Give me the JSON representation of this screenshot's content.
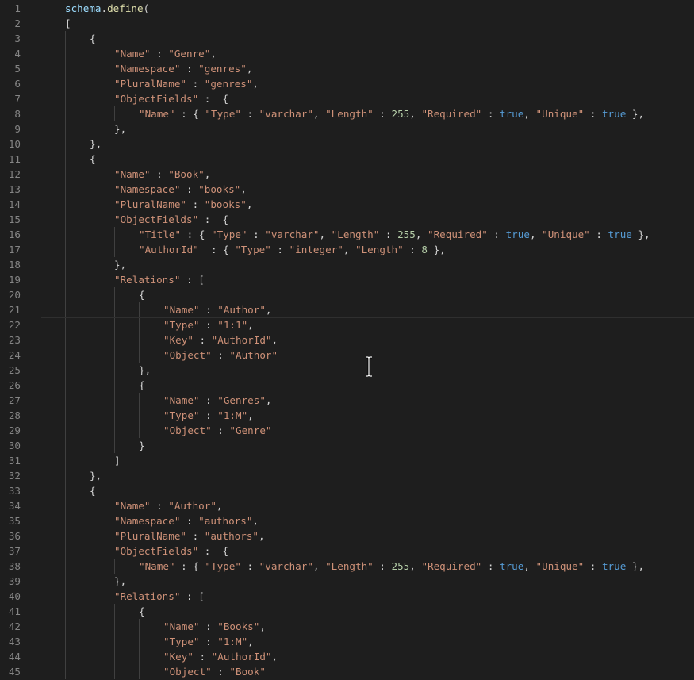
{
  "editor": {
    "lines": [
      {
        "n": "1",
        "indent": 0,
        "tokens": [
          {
            "t": "ident",
            "v": "schema"
          },
          {
            "t": "plain",
            "v": "."
          },
          {
            "t": "func",
            "v": "define"
          },
          {
            "t": "plain",
            "v": "("
          }
        ]
      },
      {
        "n": "2",
        "indent": 0,
        "tokens": [
          {
            "t": "plain",
            "v": "["
          }
        ]
      },
      {
        "n": "3",
        "indent": 1,
        "tokens": [
          {
            "t": "plain",
            "v": "{"
          }
        ]
      },
      {
        "n": "4",
        "indent": 2,
        "tokens": [
          {
            "t": "str",
            "v": "\"Name\""
          },
          {
            "t": "plain",
            "v": " : "
          },
          {
            "t": "str",
            "v": "\"Genre\""
          },
          {
            "t": "plain",
            "v": ","
          }
        ]
      },
      {
        "n": "5",
        "indent": 2,
        "tokens": [
          {
            "t": "str",
            "v": "\"Namespace\""
          },
          {
            "t": "plain",
            "v": " : "
          },
          {
            "t": "str",
            "v": "\"genres\""
          },
          {
            "t": "plain",
            "v": ","
          }
        ]
      },
      {
        "n": "6",
        "indent": 2,
        "tokens": [
          {
            "t": "str",
            "v": "\"PluralName\""
          },
          {
            "t": "plain",
            "v": " : "
          },
          {
            "t": "str",
            "v": "\"genres\""
          },
          {
            "t": "plain",
            "v": ","
          }
        ]
      },
      {
        "n": "7",
        "indent": 2,
        "tokens": [
          {
            "t": "str",
            "v": "\"ObjectFields\""
          },
          {
            "t": "plain",
            "v": " :  {"
          }
        ]
      },
      {
        "n": "8",
        "indent": 3,
        "tokens": [
          {
            "t": "str",
            "v": "\"Name\""
          },
          {
            "t": "plain",
            "v": " : { "
          },
          {
            "t": "str",
            "v": "\"Type\""
          },
          {
            "t": "plain",
            "v": " : "
          },
          {
            "t": "str",
            "v": "\"varchar\""
          },
          {
            "t": "plain",
            "v": ", "
          },
          {
            "t": "str",
            "v": "\"Length\""
          },
          {
            "t": "plain",
            "v": " : "
          },
          {
            "t": "num",
            "v": "255"
          },
          {
            "t": "plain",
            "v": ", "
          },
          {
            "t": "str",
            "v": "\"Required\""
          },
          {
            "t": "plain",
            "v": " : "
          },
          {
            "t": "kw",
            "v": "true"
          },
          {
            "t": "plain",
            "v": ", "
          },
          {
            "t": "str",
            "v": "\"Unique\""
          },
          {
            "t": "plain",
            "v": " : "
          },
          {
            "t": "kw",
            "v": "true"
          },
          {
            "t": "plain",
            "v": " },"
          }
        ]
      },
      {
        "n": "9",
        "indent": 2,
        "tokens": [
          {
            "t": "plain",
            "v": "},"
          }
        ]
      },
      {
        "n": "10",
        "indent": 1,
        "tokens": [
          {
            "t": "plain",
            "v": "},"
          }
        ]
      },
      {
        "n": "11",
        "indent": 1,
        "tokens": [
          {
            "t": "plain",
            "v": "{"
          }
        ]
      },
      {
        "n": "12",
        "indent": 2,
        "tokens": [
          {
            "t": "str",
            "v": "\"Name\""
          },
          {
            "t": "plain",
            "v": " : "
          },
          {
            "t": "str",
            "v": "\"Book\""
          },
          {
            "t": "plain",
            "v": ","
          }
        ]
      },
      {
        "n": "13",
        "indent": 2,
        "tokens": [
          {
            "t": "str",
            "v": "\"Namespace\""
          },
          {
            "t": "plain",
            "v": " : "
          },
          {
            "t": "str",
            "v": "\"books\""
          },
          {
            "t": "plain",
            "v": ","
          }
        ]
      },
      {
        "n": "14",
        "indent": 2,
        "tokens": [
          {
            "t": "str",
            "v": "\"PluralName\""
          },
          {
            "t": "plain",
            "v": " : "
          },
          {
            "t": "str",
            "v": "\"books\""
          },
          {
            "t": "plain",
            "v": ","
          }
        ]
      },
      {
        "n": "15",
        "indent": 2,
        "tokens": [
          {
            "t": "str",
            "v": "\"ObjectFields\""
          },
          {
            "t": "plain",
            "v": " :  {"
          }
        ]
      },
      {
        "n": "16",
        "indent": 3,
        "tokens": [
          {
            "t": "str",
            "v": "\"Title\""
          },
          {
            "t": "plain",
            "v": " : { "
          },
          {
            "t": "str",
            "v": "\"Type\""
          },
          {
            "t": "plain",
            "v": " : "
          },
          {
            "t": "str",
            "v": "\"varchar\""
          },
          {
            "t": "plain",
            "v": ", "
          },
          {
            "t": "str",
            "v": "\"Length\""
          },
          {
            "t": "plain",
            "v": " : "
          },
          {
            "t": "num",
            "v": "255"
          },
          {
            "t": "plain",
            "v": ", "
          },
          {
            "t": "str",
            "v": "\"Required\""
          },
          {
            "t": "plain",
            "v": " : "
          },
          {
            "t": "kw",
            "v": "true"
          },
          {
            "t": "plain",
            "v": ", "
          },
          {
            "t": "str",
            "v": "\"Unique\""
          },
          {
            "t": "plain",
            "v": " : "
          },
          {
            "t": "kw",
            "v": "true"
          },
          {
            "t": "plain",
            "v": " },"
          }
        ]
      },
      {
        "n": "17",
        "indent": 3,
        "tokens": [
          {
            "t": "str",
            "v": "\"AuthorId\""
          },
          {
            "t": "plain",
            "v": "  : { "
          },
          {
            "t": "str",
            "v": "\"Type\""
          },
          {
            "t": "plain",
            "v": " : "
          },
          {
            "t": "str",
            "v": "\"integer\""
          },
          {
            "t": "plain",
            "v": ", "
          },
          {
            "t": "str",
            "v": "\"Length\""
          },
          {
            "t": "plain",
            "v": " : "
          },
          {
            "t": "num",
            "v": "8"
          },
          {
            "t": "plain",
            "v": " },"
          }
        ]
      },
      {
        "n": "18",
        "indent": 2,
        "tokens": [
          {
            "t": "plain",
            "v": "},"
          }
        ]
      },
      {
        "n": "19",
        "indent": 2,
        "tokens": [
          {
            "t": "str",
            "v": "\"Relations\""
          },
          {
            "t": "plain",
            "v": " : ["
          }
        ]
      },
      {
        "n": "20",
        "indent": 3,
        "tokens": [
          {
            "t": "plain",
            "v": "{"
          }
        ]
      },
      {
        "n": "21",
        "indent": 4,
        "tokens": [
          {
            "t": "str",
            "v": "\"Name\""
          },
          {
            "t": "plain",
            "v": " : "
          },
          {
            "t": "str",
            "v": "\"Author\""
          },
          {
            "t": "plain",
            "v": ","
          }
        ]
      },
      {
        "n": "22",
        "indent": 4,
        "current": true,
        "tokens": [
          {
            "t": "str",
            "v": "\"Type\""
          },
          {
            "t": "plain",
            "v": " : "
          },
          {
            "t": "str",
            "v": "\"1:1\""
          },
          {
            "t": "plain",
            "v": ","
          }
        ]
      },
      {
        "n": "23",
        "indent": 4,
        "tokens": [
          {
            "t": "str",
            "v": "\"Key\""
          },
          {
            "t": "plain",
            "v": " : "
          },
          {
            "t": "str",
            "v": "\"AuthorId\""
          },
          {
            "t": "plain",
            "v": ","
          }
        ]
      },
      {
        "n": "24",
        "indent": 4,
        "tokens": [
          {
            "t": "str",
            "v": "\"Object\""
          },
          {
            "t": "plain",
            "v": " : "
          },
          {
            "t": "str",
            "v": "\"Author\""
          }
        ]
      },
      {
        "n": "25",
        "indent": 3,
        "tokens": [
          {
            "t": "plain",
            "v": "},"
          }
        ]
      },
      {
        "n": "26",
        "indent": 3,
        "tokens": [
          {
            "t": "plain",
            "v": "{"
          }
        ]
      },
      {
        "n": "27",
        "indent": 4,
        "tokens": [
          {
            "t": "str",
            "v": "\"Name\""
          },
          {
            "t": "plain",
            "v": " : "
          },
          {
            "t": "str",
            "v": "\"Genres\""
          },
          {
            "t": "plain",
            "v": ","
          }
        ]
      },
      {
        "n": "28",
        "indent": 4,
        "tokens": [
          {
            "t": "str",
            "v": "\"Type\""
          },
          {
            "t": "plain",
            "v": " : "
          },
          {
            "t": "str",
            "v": "\"1:M\""
          },
          {
            "t": "plain",
            "v": ","
          }
        ]
      },
      {
        "n": "29",
        "indent": 4,
        "tokens": [
          {
            "t": "str",
            "v": "\"Object\""
          },
          {
            "t": "plain",
            "v": " : "
          },
          {
            "t": "str",
            "v": "\"Genre\""
          }
        ]
      },
      {
        "n": "30",
        "indent": 3,
        "tokens": [
          {
            "t": "plain",
            "v": "}"
          }
        ]
      },
      {
        "n": "31",
        "indent": 2,
        "tokens": [
          {
            "t": "plain",
            "v": "]"
          }
        ]
      },
      {
        "n": "32",
        "indent": 1,
        "tokens": [
          {
            "t": "plain",
            "v": "},"
          }
        ]
      },
      {
        "n": "33",
        "indent": 1,
        "tokens": [
          {
            "t": "plain",
            "v": "{"
          }
        ]
      },
      {
        "n": "34",
        "indent": 2,
        "tokens": [
          {
            "t": "str",
            "v": "\"Name\""
          },
          {
            "t": "plain",
            "v": " : "
          },
          {
            "t": "str",
            "v": "\"Author\""
          },
          {
            "t": "plain",
            "v": ","
          }
        ]
      },
      {
        "n": "35",
        "indent": 2,
        "tokens": [
          {
            "t": "str",
            "v": "\"Namespace\""
          },
          {
            "t": "plain",
            "v": " : "
          },
          {
            "t": "str",
            "v": "\"authors\""
          },
          {
            "t": "plain",
            "v": ","
          }
        ]
      },
      {
        "n": "36",
        "indent": 2,
        "tokens": [
          {
            "t": "str",
            "v": "\"PluralName\""
          },
          {
            "t": "plain",
            "v": " : "
          },
          {
            "t": "str",
            "v": "\"authors\""
          },
          {
            "t": "plain",
            "v": ","
          }
        ]
      },
      {
        "n": "37",
        "indent": 2,
        "tokens": [
          {
            "t": "str",
            "v": "\"ObjectFields\""
          },
          {
            "t": "plain",
            "v": " :  {"
          }
        ]
      },
      {
        "n": "38",
        "indent": 3,
        "tokens": [
          {
            "t": "str",
            "v": "\"Name\""
          },
          {
            "t": "plain",
            "v": " : { "
          },
          {
            "t": "str",
            "v": "\"Type\""
          },
          {
            "t": "plain",
            "v": " : "
          },
          {
            "t": "str",
            "v": "\"varchar\""
          },
          {
            "t": "plain",
            "v": ", "
          },
          {
            "t": "str",
            "v": "\"Length\""
          },
          {
            "t": "plain",
            "v": " : "
          },
          {
            "t": "num",
            "v": "255"
          },
          {
            "t": "plain",
            "v": ", "
          },
          {
            "t": "str",
            "v": "\"Required\""
          },
          {
            "t": "plain",
            "v": " : "
          },
          {
            "t": "kw",
            "v": "true"
          },
          {
            "t": "plain",
            "v": ", "
          },
          {
            "t": "str",
            "v": "\"Unique\""
          },
          {
            "t": "plain",
            "v": " : "
          },
          {
            "t": "kw",
            "v": "true"
          },
          {
            "t": "plain",
            "v": " },"
          }
        ]
      },
      {
        "n": "39",
        "indent": 2,
        "tokens": [
          {
            "t": "plain",
            "v": "},"
          }
        ]
      },
      {
        "n": "40",
        "indent": 2,
        "tokens": [
          {
            "t": "str",
            "v": "\"Relations\""
          },
          {
            "t": "plain",
            "v": " : ["
          }
        ]
      },
      {
        "n": "41",
        "indent": 3,
        "tokens": [
          {
            "t": "plain",
            "v": "{"
          }
        ]
      },
      {
        "n": "42",
        "indent": 4,
        "tokens": [
          {
            "t": "str",
            "v": "\"Name\""
          },
          {
            "t": "plain",
            "v": " : "
          },
          {
            "t": "str",
            "v": "\"Books\""
          },
          {
            "t": "plain",
            "v": ","
          }
        ]
      },
      {
        "n": "43",
        "indent": 4,
        "tokens": [
          {
            "t": "str",
            "v": "\"Type\""
          },
          {
            "t": "plain",
            "v": " : "
          },
          {
            "t": "str",
            "v": "\"1:M\""
          },
          {
            "t": "plain",
            "v": ","
          }
        ]
      },
      {
        "n": "44",
        "indent": 4,
        "tokens": [
          {
            "t": "str",
            "v": "\"Key\""
          },
          {
            "t": "plain",
            "v": " : "
          },
          {
            "t": "str",
            "v": "\"AuthorId\""
          },
          {
            "t": "plain",
            "v": ","
          }
        ]
      },
      {
        "n": "45",
        "indent": 4,
        "tokens": [
          {
            "t": "str",
            "v": "\"Object\""
          },
          {
            "t": "plain",
            "v": " : "
          },
          {
            "t": "str",
            "v": "\"Book\""
          }
        ]
      }
    ]
  },
  "cursor": {
    "icon": "text-ibeam-cursor-icon"
  },
  "colors": {
    "background": "#1e1e1e",
    "line_number": "#858585",
    "plain": "#d4d4d4",
    "identifier": "#9cdcfe",
    "function": "#dcdcaa",
    "string": "#ce9178",
    "number": "#b5cea8",
    "keyword": "#569cd6",
    "indent_guide": "#404040",
    "current_line_border": "#2f2f2f"
  }
}
